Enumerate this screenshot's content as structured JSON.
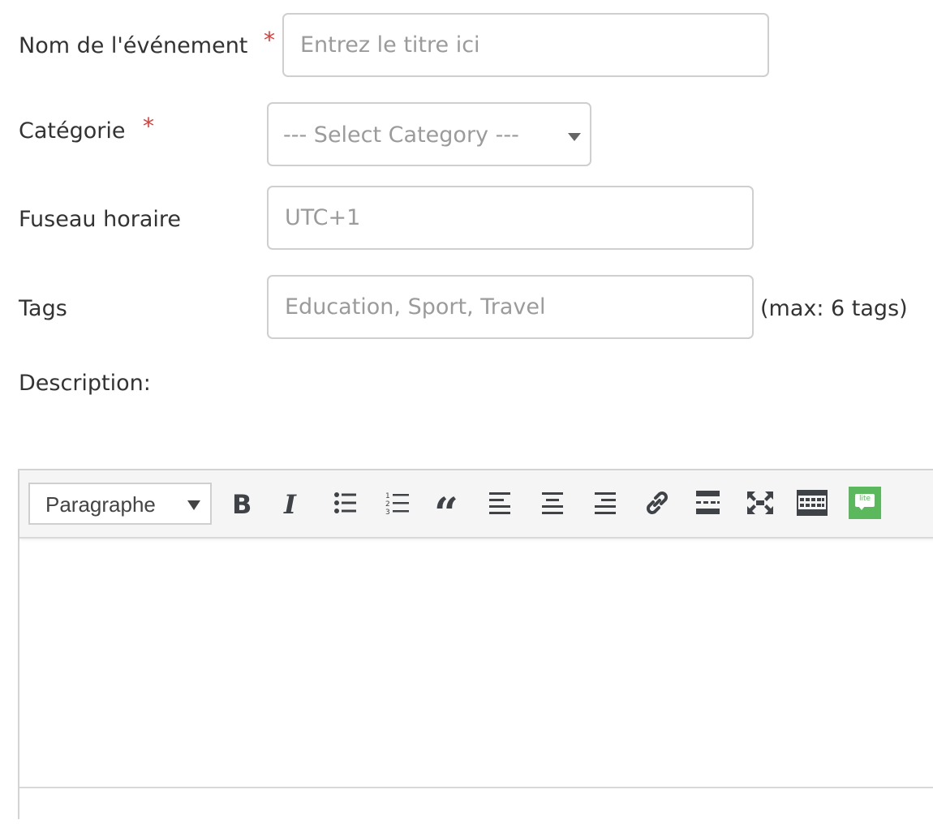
{
  "form": {
    "event_name": {
      "label": "Nom de l'événement",
      "required_mark": "*",
      "placeholder": "Entrez le titre ici",
      "value": ""
    },
    "category": {
      "label": "Catégorie",
      "required_mark": "*",
      "selected": "--- Select Category ---"
    },
    "timezone": {
      "label": "Fuseau horaire",
      "placeholder": "UTC+1",
      "value": ""
    },
    "tags": {
      "label": "Tags",
      "placeholder": "Education, Sport, Travel",
      "value": "",
      "hint": "(max: 6 tags)"
    },
    "description": {
      "label": "Description:"
    }
  },
  "editor": {
    "format_select": "Paragraphe",
    "toolbar_icons": [
      "bold-icon",
      "italic-icon",
      "bullet-list-icon",
      "numbered-list-icon",
      "blockquote-icon",
      "align-left-icon",
      "align-center-icon",
      "align-right-icon",
      "link-icon",
      "horizontal-rule-icon",
      "fullscreen-icon",
      "table-icon",
      "lite-plugin-icon"
    ],
    "lite_badge": "lite",
    "content": ""
  },
  "colors": {
    "required": "#e53935",
    "toolbar_bg": "#f4f5f4",
    "icon": "#3f4246",
    "lite_badge": "#5cb85c"
  }
}
